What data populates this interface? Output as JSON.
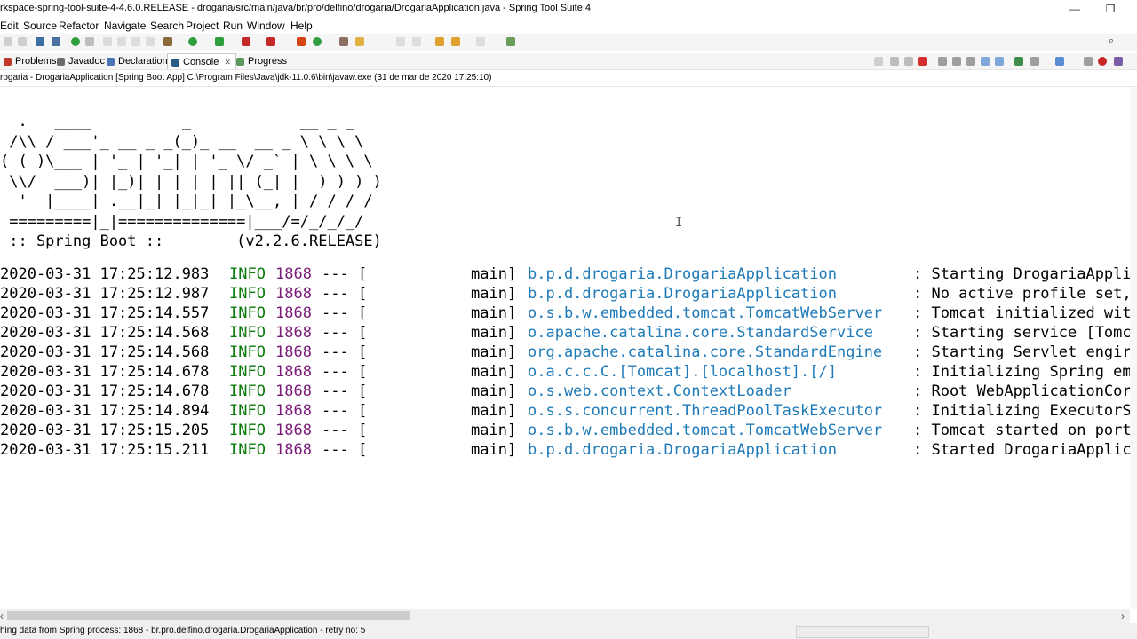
{
  "window": {
    "title": "rkspace-spring-tool-suite-4-4.6.0.RELEASE - drogaria/src/main/java/br/pro/delfino/drogaria/DrogariaApplication.java - Spring Tool Suite 4",
    "minimize_glyph": "—",
    "restore_glyph": "❐"
  },
  "menu": [
    "Edit",
    "Source",
    "Refactor",
    "Navigate",
    "Search",
    "Project",
    "Run",
    "Window",
    "Help"
  ],
  "tabs": [
    {
      "label": "Problems",
      "icon": "problems-icon"
    },
    {
      "label": "Javadoc",
      "icon": "javadoc-icon"
    },
    {
      "label": "Declaration",
      "icon": "declaration-icon"
    },
    {
      "label": "Console",
      "icon": "console-icon",
      "active": true
    },
    {
      "label": "Progress",
      "icon": "progress-icon"
    }
  ],
  "console_tab_close": "✕",
  "launch_info": "rogaria - DrogariaApplication [Spring Boot App] C:\\Program Files\\Java\\jdk-11.0.6\\bin\\javaw.exe  (31 de mar de 2020 17:25:10)",
  "banner": "  .   ____          _            __ _ _\n /\\\\ / ___'_ __ _ _(_)_ __  __ _ \\ \\ \\ \\\n( ( )\\___ | '_ | '_| | '_ \\/ _` | \\ \\ \\ \\\n \\\\/  ___)| |_)| | | | | || (_| |  ) ) ) )\n  '  |____| .__|_| |_|_| |_\\__, | / / / /\n =========|_|==============|___/=/_/_/_/\n :: Spring Boot ::        (v2.2.6.RELEASE)",
  "log": [
    {
      "ts": "2020-03-31 17:25:12.983",
      "level": "INFO",
      "pid": "1868",
      "sep": "--- [",
      "thread": "main]",
      "logger": "b.p.d.drogaria.DrogariaApplication",
      "msg": ": Starting DrogariaAppli"
    },
    {
      "ts": "2020-03-31 17:25:12.987",
      "level": "INFO",
      "pid": "1868",
      "sep": "--- [",
      "thread": "main]",
      "logger": "b.p.d.drogaria.DrogariaApplication",
      "msg": ": No active profile set,"
    },
    {
      "ts": "2020-03-31 17:25:14.557",
      "level": "INFO",
      "pid": "1868",
      "sep": "--- [",
      "thread": "main]",
      "logger": "o.s.b.w.embedded.tomcat.TomcatWebServer",
      "msg": ": Tomcat initialized wit"
    },
    {
      "ts": "2020-03-31 17:25:14.568",
      "level": "INFO",
      "pid": "1868",
      "sep": "--- [",
      "thread": "main]",
      "logger": "o.apache.catalina.core.StandardService",
      "msg": ": Starting service [Tomc"
    },
    {
      "ts": "2020-03-31 17:25:14.568",
      "level": "INFO",
      "pid": "1868",
      "sep": "--- [",
      "thread": "main]",
      "logger": "org.apache.catalina.core.StandardEngine",
      "msg": ": Starting Servlet engir"
    },
    {
      "ts": "2020-03-31 17:25:14.678",
      "level": "INFO",
      "pid": "1868",
      "sep": "--- [",
      "thread": "main]",
      "logger": "o.a.c.c.C.[Tomcat].[localhost].[/]",
      "msg": ": Initializing Spring em"
    },
    {
      "ts": "2020-03-31 17:25:14.678",
      "level": "INFO",
      "pid": "1868",
      "sep": "--- [",
      "thread": "main]",
      "logger": "o.s.web.context.ContextLoader",
      "msg": ": Root WebApplicationCor"
    },
    {
      "ts": "2020-03-31 17:25:14.894",
      "level": "INFO",
      "pid": "1868",
      "sep": "--- [",
      "thread": "main]",
      "logger": "o.s.s.concurrent.ThreadPoolTaskExecutor",
      "msg": ": Initializing ExecutorS"
    },
    {
      "ts": "2020-03-31 17:25:15.205",
      "level": "INFO",
      "pid": "1868",
      "sep": "--- [",
      "thread": "main]",
      "logger": "o.s.b.w.embedded.tomcat.TomcatWebServer",
      "msg": ": Tomcat started on port"
    },
    {
      "ts": "2020-03-31 17:25:15.211",
      "level": "INFO",
      "pid": "1868",
      "sep": "--- [",
      "thread": "main]",
      "logger": "b.p.d.drogaria.DrogariaApplication",
      "msg": ": Started DrogariaApplic"
    }
  ],
  "status": "hing data from Spring process: 1868 - br.pro.delfino.drogaria.DrogariaApplication - retry no: 5",
  "colors": {
    "info": "#0a7a0a",
    "pid": "#7b1b79",
    "logger": "#1e7ab8"
  }
}
